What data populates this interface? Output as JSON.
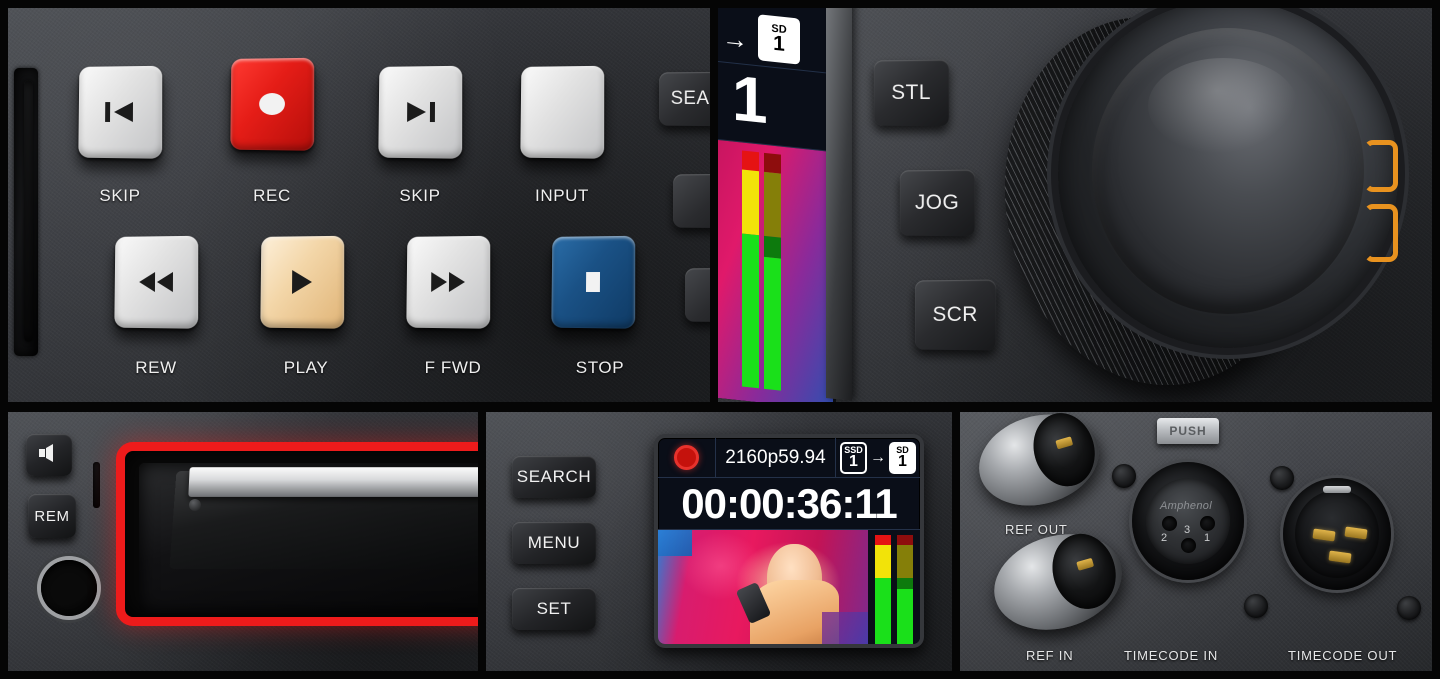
{
  "device": {
    "brand_context": "broadcast deck control panel",
    "panels": [
      "transport-controls",
      "lcd-jog-wheel",
      "media-slot",
      "status-display",
      "rear-connectors"
    ]
  },
  "transport": {
    "row1": [
      {
        "label": "SKIP",
        "icon": "skip-back-icon",
        "color": "#e2e2e2",
        "style": "wht"
      },
      {
        "label": "REC",
        "icon": "record-dot-icon",
        "color": "#e51d17",
        "style": "red"
      },
      {
        "label": "SKIP",
        "icon": "skip-forward-icon",
        "color": "#e2e2e2",
        "style": "wht"
      },
      {
        "label": "INPUT",
        "icon": "blank-icon",
        "color": "#e2e2e2",
        "style": "wht"
      }
    ],
    "row2": [
      {
        "label": "REW",
        "icon": "rewind-icon",
        "color": "#e2e2e2",
        "style": "wht"
      },
      {
        "label": "PLAY",
        "icon": "play-icon",
        "color": "#f3d6a8",
        "style": "cream"
      },
      {
        "label": "F FWD",
        "icon": "fast-forward-icon",
        "color": "#e2e2e2",
        "style": "wht"
      },
      {
        "label": "STOP",
        "icon": "stop-square-icon",
        "color": "#1a5185",
        "style": "blue"
      }
    ],
    "side_keys": [
      {
        "label": "SEARCH",
        "truncated": "SEA"
      },
      {
        "label": ""
      },
      {
        "label": ""
      }
    ]
  },
  "jog_panel": {
    "buttons": [
      {
        "label": "STL"
      },
      {
        "label": "JOG"
      },
      {
        "label": "SCR"
      }
    ],
    "jog_wheel_name": "jog-shuttle-wheel",
    "lcd": {
      "arrow": "→",
      "dest_badge": {
        "top": "SD",
        "bottom": "1"
      },
      "timecode_digit": "1",
      "meters": [
        {
          "name": "audio-ch1",
          "red": 8,
          "yellow": 27,
          "green": 65,
          "dim": false
        },
        {
          "name": "audio-ch2",
          "red": 8,
          "yellow": 27,
          "green": 65,
          "dim": true
        }
      ]
    }
  },
  "media_panel": {
    "buttons": [
      {
        "label": "",
        "icon": "speaker-icon"
      },
      {
        "label": "REM",
        "icon": null
      }
    ],
    "headphone_jack": "headphone-jack",
    "slot_led_color": "#ee1b1b",
    "slot_name": "ssd-media-slot"
  },
  "status_panel": {
    "buttons": [
      {
        "label": "SEARCH"
      },
      {
        "label": "MENU"
      },
      {
        "label": "SET"
      }
    ],
    "lcd": {
      "rec_indicator": "record-dot-icon",
      "format": "2160p59.94",
      "source_badge": {
        "top": "SSD",
        "bottom": "1"
      },
      "arrow": "→",
      "dest_badge": {
        "top": "SD",
        "bottom": "1"
      },
      "timecode": "00:00:36:11",
      "meters": [
        {
          "name": "audio-ch1",
          "red": 9,
          "yellow": 30,
          "green": 61,
          "dim": false
        },
        {
          "name": "audio-ch2",
          "red": 9,
          "yellow": 30,
          "green": 61,
          "dim": true
        }
      ]
    }
  },
  "connector_panel": {
    "labels": {
      "ref_out": "REF OUT",
      "ref_in": "REF IN",
      "timecode_in": "TIMECODE IN",
      "timecode_out": "TIMECODE OUT"
    },
    "push_tab": "PUSH",
    "xlr_brand": "Amphenol",
    "xlr_pins": [
      "2",
      "3",
      "1"
    ]
  }
}
